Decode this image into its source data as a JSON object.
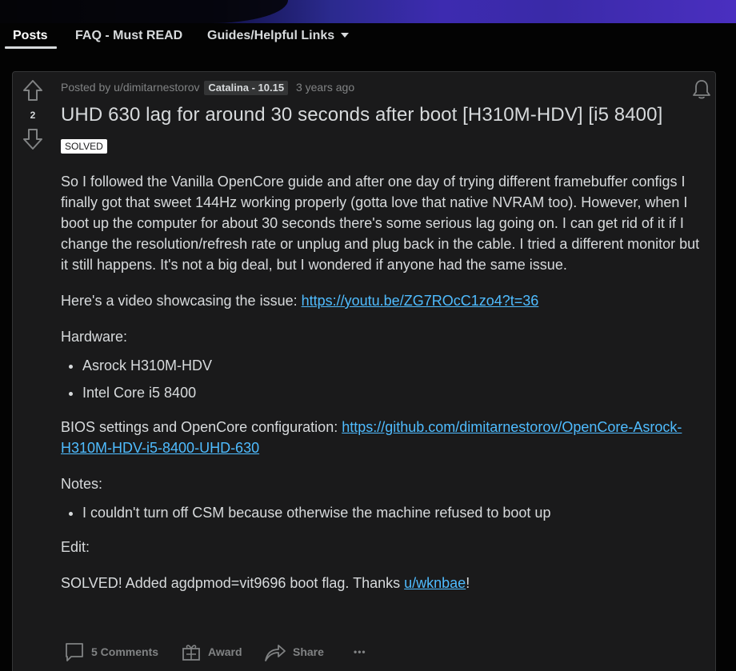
{
  "nav": {
    "tabs": [
      {
        "label": "Posts",
        "active": true
      },
      {
        "label": "FAQ - Must READ",
        "active": false
      },
      {
        "label": "Guides/Helpful Links",
        "active": false,
        "dropdown": true
      }
    ]
  },
  "post": {
    "score": "2",
    "posted_by": "Posted by u/dimitarnestorov",
    "version_flair": "Catalina - 10.15",
    "time": "3 years ago",
    "title": "UHD 630 lag for around 30 seconds after boot [H310M-HDV] [i5 8400]",
    "status_flair": "SOLVED",
    "body": {
      "p1": "So I followed the Vanilla OpenCore guide and after one day of trying different framebuffer configs I finally got that sweet 144Hz working properly (gotta love that native NVRAM too). However, when I boot up the computer for about 30 seconds there's some serious lag going on. I can get rid of it if I change the resolution/refresh rate or unplug and plug back in the cable. I tried a different monitor but it still happens. It's not a big deal, but I wondered if anyone had the same issue.",
      "video_text": "Here's a video showcasing the issue: ",
      "video_link": "https://youtu.be/ZG7ROcC1zo4?t=36",
      "hardware_heading": "Hardware:",
      "hardware": [
        "Asrock H310M-HDV",
        "Intel Core i5 8400"
      ],
      "bios_text": "BIOS settings and OpenCore configuration: ",
      "bios_link": "https://github.com/dimitarnestorov/OpenCore-Asrock-H310M-HDV-i5-8400-UHD-630",
      "notes_heading": "Notes:",
      "notes": [
        "I couldn't turn off CSM because otherwise the machine refused to boot up"
      ],
      "edit_heading": "Edit:",
      "solved_text": "SOLVED! Added agdpmod=vit9696 boot flag. Thanks ",
      "solved_user": "u/wknbae",
      "solved_end": "!"
    },
    "actions": {
      "comments": "5 Comments",
      "award": "Award",
      "share": "Share",
      "more": "•••"
    }
  },
  "colors": {
    "background": "#030303",
    "card": "#1a1a1b",
    "text": "#d7dadc",
    "muted": "#818384",
    "link": "#4fbcff"
  },
  "icons": [
    "upvote-icon",
    "downvote-icon",
    "bell-icon",
    "comment-icon",
    "award-icon",
    "share-icon",
    "more-icon",
    "chevron-down-icon"
  ]
}
